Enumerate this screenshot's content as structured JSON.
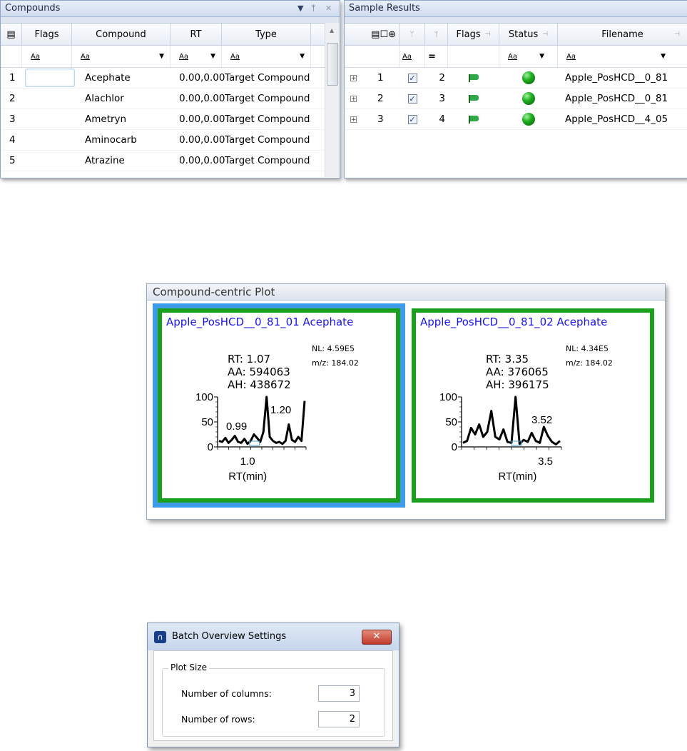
{
  "compounds": {
    "title": "Compounds",
    "columns": [
      "Flags",
      "Compound",
      "RT",
      "Type"
    ],
    "filter_label": "Aa",
    "rows": [
      {
        "num": "1",
        "compound": "Acephate",
        "rt": "0.00,0.00",
        "type": "Target Compound"
      },
      {
        "num": "2",
        "compound": "Alachlor",
        "rt": "0.00,0.00",
        "type": "Target Compound"
      },
      {
        "num": "3",
        "compound": "Ametryn",
        "rt": "0.00,0.00",
        "type": "Target Compound"
      },
      {
        "num": "4",
        "compound": "Aminocarb",
        "rt": "0.00,0.00",
        "type": "Target Compound"
      },
      {
        "num": "5",
        "compound": "Atrazine",
        "rt": "0.00,0.00",
        "type": "Target Compound"
      }
    ]
  },
  "sample_results": {
    "title": "Sample Results",
    "columns": [
      "Flags",
      "Status",
      "Filename"
    ],
    "filter_label": "Aa",
    "filter_eq": "=",
    "rows": [
      {
        "num": "1",
        "seq": "2",
        "filename": "Apple_PosHCD__0_81"
      },
      {
        "num": "2",
        "seq": "3",
        "filename": "Apple_PosHCD__0_81"
      },
      {
        "num": "3",
        "seq": "4",
        "filename": "Apple_PosHCD__4_05"
      }
    ]
  },
  "plot_panel": {
    "title": "Compound-centric Plot",
    "cells": [
      {
        "title": "Apple_PosHCD__0_81_01   Acephate",
        "nl": "NL: 4.59E5",
        "mz": "m/z: 184.02",
        "rt": "RT: 1.07",
        "aa": "AA: 594063",
        "ah": "AH: 438672",
        "selected": true
      },
      {
        "title": "Apple_PosHCD__0_81_02   Acephate",
        "nl": "NL: 4.34E5",
        "mz": "m/z: 184.02",
        "rt": "RT: 3.35",
        "aa": "AA: 376065",
        "ah": "AH: 396175",
        "selected": false
      }
    ]
  },
  "chart_data": [
    {
      "type": "line",
      "xlabel": "RT(min)",
      "ylabel": "",
      "ylim": [
        0,
        100
      ],
      "yticks": [
        "0",
        "50",
        "100"
      ],
      "xtick_labels": [
        "1.0"
      ],
      "peak_labels": [
        "0.99",
        "1.20"
      ],
      "series": [
        {
          "values": [
            12,
            10,
            18,
            8,
            14,
            22,
            10,
            8,
            16,
            6,
            12,
            25,
            18,
            10,
            30,
            100,
            20,
            12,
            8,
            10,
            6,
            12,
            45,
            14,
            10,
            20,
            12,
            92
          ]
        }
      ]
    },
    {
      "type": "line",
      "xlabel": "RT(min)",
      "ylabel": "",
      "ylim": [
        0,
        100
      ],
      "yticks": [
        "0",
        "50",
        "100"
      ],
      "xtick_labels": [
        "3.5"
      ],
      "peak_labels": [
        "3.52"
      ],
      "series": [
        {
          "values": [
            8,
            12,
            38,
            25,
            45,
            20,
            30,
            72,
            20,
            15,
            35,
            10,
            8,
            100,
            6,
            14,
            10,
            28,
            12,
            8,
            40,
            22,
            10,
            5,
            12
          ]
        }
      ]
    }
  ],
  "settings_dialog": {
    "title": "Batch Overview Settings",
    "close_label": "✕",
    "group_label": "Plot Size",
    "columns_label": "Number of columns:",
    "columns_value": "3",
    "rows_label": "Number of rows:",
    "rows_value": "2"
  }
}
